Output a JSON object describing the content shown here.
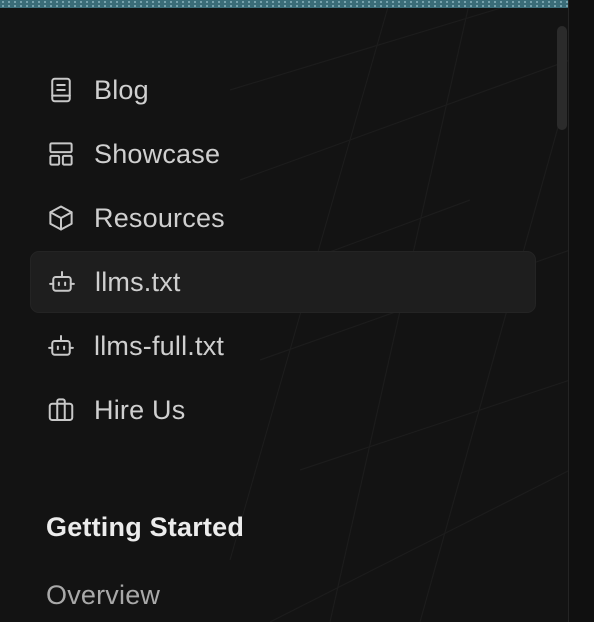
{
  "colors": {
    "background": "#131313",
    "active_item_background": "#1e1e1e",
    "text": "#cfcfcf",
    "section_title": "#ececec",
    "muted_text": "#a9a9a9",
    "top_strip": "#3a6c78"
  },
  "nav": {
    "items": [
      {
        "label": "Blog",
        "icon": "book-icon",
        "active": false
      },
      {
        "label": "Showcase",
        "icon": "layout-icon",
        "active": false
      },
      {
        "label": "Resources",
        "icon": "box-icon",
        "active": false
      },
      {
        "label": "llms.txt",
        "icon": "bot-icon",
        "active": true
      },
      {
        "label": "llms-full.txt",
        "icon": "bot-icon",
        "active": false
      },
      {
        "label": "Hire Us",
        "icon": "briefcase-icon",
        "active": false
      }
    ]
  },
  "sections": [
    {
      "title": "Getting Started",
      "links": [
        "Overview"
      ]
    }
  ]
}
